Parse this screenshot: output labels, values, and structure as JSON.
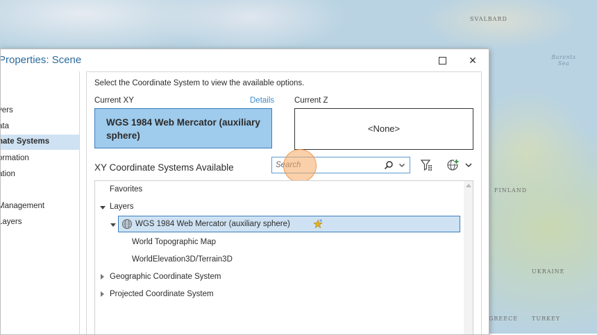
{
  "map": {
    "labels": {
      "svalbard": "SVALBARD",
      "barents_sea": "Barents Sea",
      "finland": "FINLAND",
      "ukraine": "UKRAINE",
      "greece": "GREECE",
      "turkey": "TURKEY"
    }
  },
  "dialog": {
    "title": "Properties: Scene",
    "controls": {
      "maximize": "☐",
      "close": "✕"
    }
  },
  "sidebar": {
    "items": [
      {
        "label": "l"
      },
      {
        "label": ""
      },
      {
        "label": "yers"
      },
      {
        "label": "ata"
      },
      {
        "label": "nate Systems",
        "selected": true
      },
      {
        "label": "ormation"
      },
      {
        "label": "ation"
      },
      {
        "label": ""
      },
      {
        "label": "Management"
      },
      {
        "label": "Layers"
      }
    ]
  },
  "content": {
    "instruction": "Select the Coordinate System to view the available options.",
    "current_xy_label": "Current XY",
    "details_link": "Details",
    "current_xy_value": "WGS 1984 Web Mercator (auxiliary sphere)",
    "current_z_label": "Current Z",
    "current_z_value": "<None>",
    "section_title": "XY Coordinate Systems Available",
    "search": {
      "placeholder": "Search",
      "value": ""
    },
    "icons": {
      "search": "search-icon",
      "dropdown": "chevron-down-icon",
      "filter": "filter-icon",
      "add_globe": "add-coordinate-system-globe-icon",
      "favorite": "star-icon",
      "globe": "globe-icon"
    },
    "tree": {
      "favorites": "Favorites",
      "layers": "Layers",
      "layers_child": "WGS 1984 Web Mercator (auxiliary sphere)",
      "sub_items": [
        "World Topographic Map",
        "WorldElevation3D/Terrain3D"
      ],
      "geographic": "Geographic Coordinate System",
      "projected": "Projected Coordinate System"
    }
  },
  "colors": {
    "accent": "#3b8ccc",
    "selection": "#cfe2f3",
    "current_xy_fill": "#9fcbec",
    "click_highlight": "#f6aa64"
  }
}
